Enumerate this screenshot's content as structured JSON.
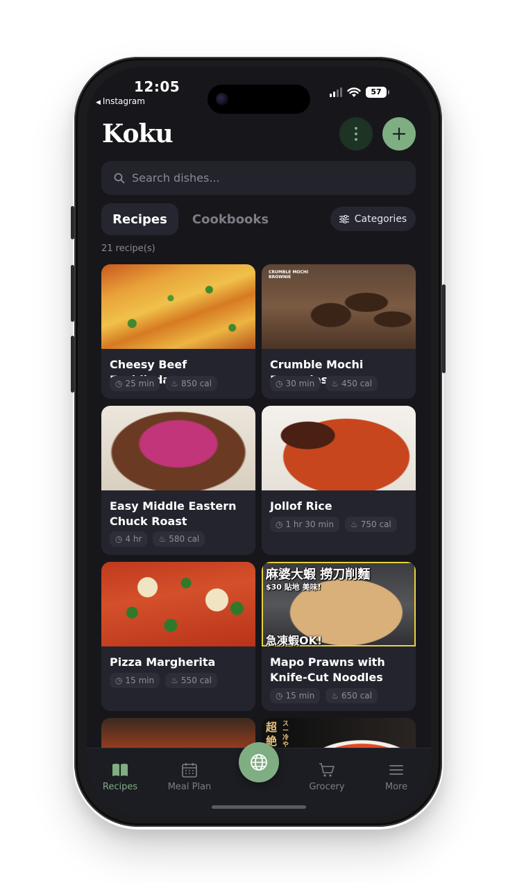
{
  "status": {
    "time": "12:05",
    "back_app": "Instagram",
    "battery": "57"
  },
  "header": {
    "title": "Koku"
  },
  "search": {
    "placeholder": "Search dishes..."
  },
  "tabs": [
    {
      "label": "Recipes",
      "active": true
    },
    {
      "label": "Cookbooks",
      "active": false
    }
  ],
  "categories_label": "Categories",
  "recipe_count": "21 recipe(s)",
  "recipes": [
    {
      "title": "Cheesy Beef Enchiladas",
      "time": "25 min",
      "calories": "850 cal"
    },
    {
      "title": "Crumble Mochi Brownies",
      "time": "30 min",
      "calories": "450 cal",
      "image_text": [
        "CRUMBLE MOCHI",
        "BROWNIE"
      ]
    },
    {
      "title": "Easy Middle Eastern Chuck Roast",
      "time": "4 hr",
      "calories": "580 cal"
    },
    {
      "title": "Jollof Rice",
      "time": "1 hr 30 min",
      "calories": "750 cal"
    },
    {
      "title": "Pizza Margherita",
      "time": "15 min",
      "calories": "550 cal"
    },
    {
      "title": "Mapo Prawns with Knife-Cut Noodles",
      "time": "15 min",
      "calories": "650 cal",
      "image_text": [
        "麻婆大蝦 撈刀削麵",
        "$30 貼地 美味!",
        "急凍蝦OK!"
      ]
    },
    {
      "title": "",
      "time": "",
      "calories": ""
    },
    {
      "title": "",
      "time": "",
      "calories": "",
      "image_text": [
        "超",
        "絶",
        "スー",
        "冷やし"
      ]
    }
  ],
  "nav": [
    {
      "label": "Recipes",
      "icon": "book-icon",
      "active": true
    },
    {
      "label": "Meal Plan",
      "icon": "calendar-icon",
      "active": false
    },
    {
      "label": "Grocery",
      "icon": "cart-icon",
      "active": false
    },
    {
      "label": "More",
      "icon": "menu-icon",
      "active": false
    }
  ],
  "colors": {
    "accent": "#7fae83",
    "background": "#17171b",
    "card": "#24242e"
  }
}
